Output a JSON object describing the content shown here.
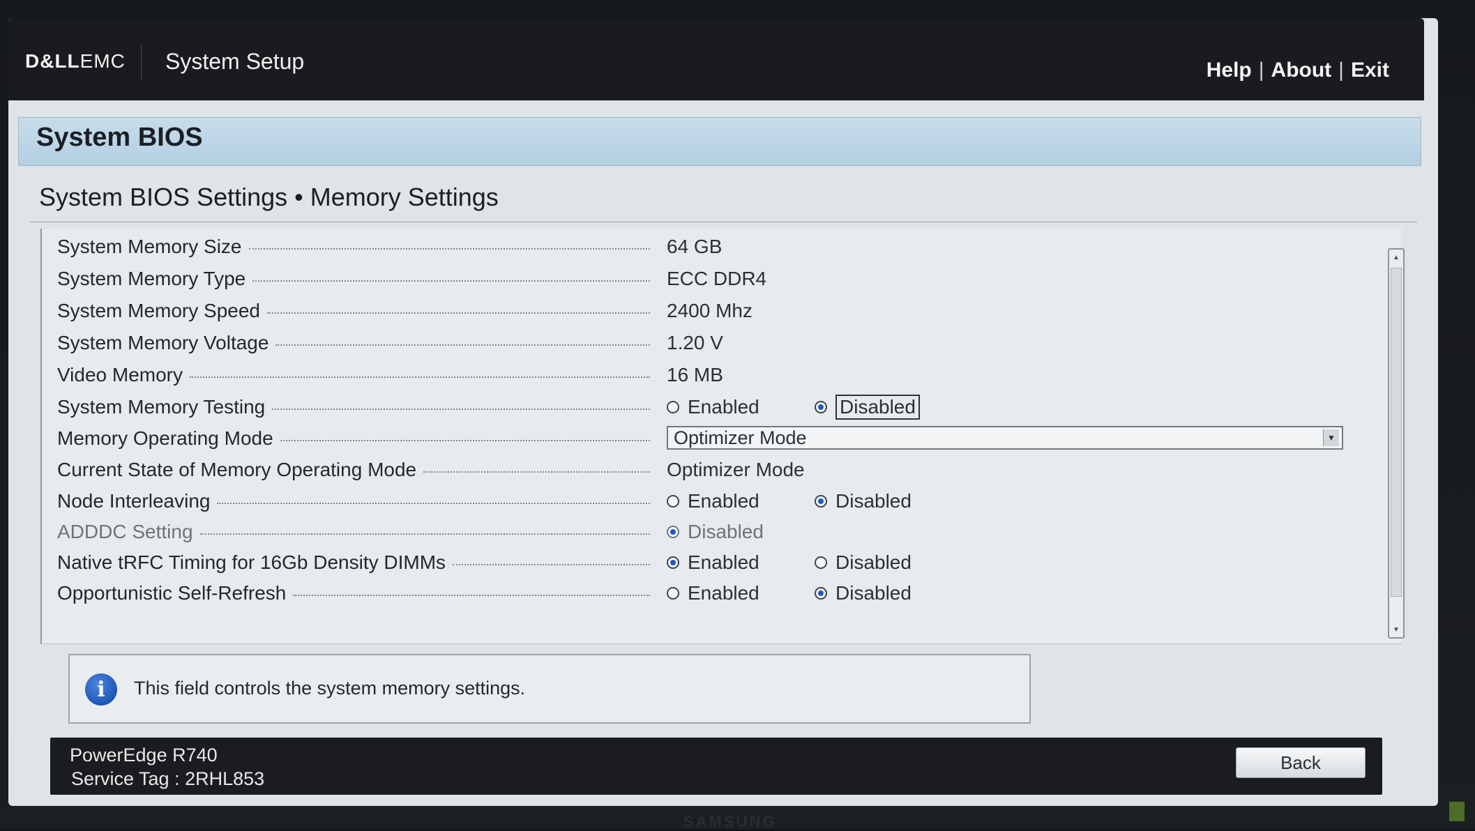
{
  "header": {
    "logo_dell": "D&LL",
    "logo_emc": "EMC",
    "app_title": "System Setup",
    "links": [
      "Help",
      "About",
      "Exit"
    ]
  },
  "section_title": "System BIOS",
  "page_title": "System BIOS Settings • Memory Settings",
  "settings": {
    "memory_size": {
      "label": "System Memory Size",
      "value": "64 GB"
    },
    "memory_type": {
      "label": "System Memory Type",
      "value": "ECC DDR4"
    },
    "memory_speed": {
      "label": "System Memory Speed",
      "value": "2400 Mhz"
    },
    "memory_voltage": {
      "label": "System Memory Voltage",
      "value": "1.20 V"
    },
    "video_memory": {
      "label": "Video Memory",
      "value": "16 MB"
    },
    "memory_testing": {
      "label": "System Memory Testing",
      "opt1": "Enabled",
      "opt2": "Disabled",
      "selected": "Disabled"
    },
    "operating_mode": {
      "label": "Memory Operating Mode",
      "value": "Optimizer Mode"
    },
    "current_mode": {
      "label": "Current State of Memory Operating Mode",
      "value": "Optimizer Mode"
    },
    "node_interleaving": {
      "label": "Node Interleaving",
      "opt1": "Enabled",
      "opt2": "Disabled",
      "selected": "Disabled"
    },
    "adddc": {
      "label": "ADDDC Setting",
      "opt1": "Disabled",
      "selected": "Disabled"
    },
    "native_trfc": {
      "label": "Native tRFC Timing for 16Gb Density DIMMs",
      "opt1": "Enabled",
      "opt2": "Disabled",
      "selected": "Enabled"
    },
    "self_refresh": {
      "label": "Opportunistic Self-Refresh",
      "opt1": "Enabled",
      "opt2": "Disabled",
      "selected": "Disabled"
    }
  },
  "help_text": "This field controls the system memory settings.",
  "footer": {
    "model": "PowerEdge R740",
    "service_tag": "Service Tag : 2RHL853",
    "back_label": "Back"
  },
  "monitor_brand": "SAMSUNG",
  "colors": {
    "accent_radio": "#1f58c0",
    "header_bg": "#1a1b1f",
    "band": "#c7dcea"
  }
}
